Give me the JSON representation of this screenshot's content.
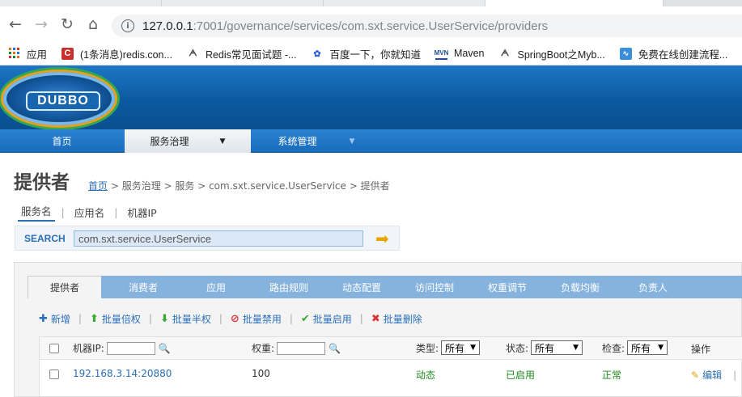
{
  "browser": {
    "url_host": "127.0.0.1",
    "url_rest": ":7001/governance/services/com.sxt.service.UserService/providers",
    "bookmarks": [
      {
        "icon": "apps-grid-icon",
        "label": "应用"
      },
      {
        "icon": "csdn-icon",
        "label": "(1条消息)redis.con..."
      },
      {
        "icon": "fox-icon",
        "label": "Redis常见面试题 -..."
      },
      {
        "icon": "baidu-paw-icon",
        "label": "百度一下，你就知道"
      },
      {
        "icon": "mvn-icon",
        "label": "Maven"
      },
      {
        "icon": "fox-icon",
        "label": "SpringBoot之Myb..."
      },
      {
        "icon": "chart-icon",
        "label": "免费在线创建流程..."
      }
    ]
  },
  "header": {
    "logo_text": "DUBBO"
  },
  "nav": {
    "items": [
      {
        "label": "首页"
      },
      {
        "label": "服务治理",
        "caret": "▼"
      },
      {
        "label": "系统管理",
        "caret": "▼"
      }
    ]
  },
  "page": {
    "title": "提供者",
    "breadcrumb": {
      "home": "首页",
      "trail": " > 服务治理 > 服务 > com.sxt.service.UserService > 提供者"
    }
  },
  "search": {
    "tabs": [
      "服务名",
      "应用名",
      "机器IP"
    ],
    "label": "SEARCH",
    "value": "com.sxt.service.UserService"
  },
  "tabs": [
    "提供者",
    "消费者",
    "应用",
    "路由规则",
    "动态配置",
    "访问控制",
    "权重调节",
    "负载均衡",
    "负责人"
  ],
  "actions": [
    {
      "icon": "plus-icon",
      "glyph": "✚",
      "label": "新增",
      "color": "#2a6fb8"
    },
    {
      "icon": "up-arrow-icon",
      "glyph": "⬆",
      "label": "批量倍权",
      "color": "#3aa83a"
    },
    {
      "icon": "down-arrow-icon",
      "glyph": "⬇",
      "label": "批量半权",
      "color": "#3aa83a"
    },
    {
      "icon": "ban-icon",
      "glyph": "⊘",
      "label": "批量禁用",
      "color": "#d33"
    },
    {
      "icon": "check-icon",
      "glyph": "✔",
      "label": "批量启用",
      "color": "#3aa83a"
    },
    {
      "icon": "cross-icon",
      "glyph": "✖",
      "label": "批量删除",
      "color": "#d33"
    }
  ],
  "table": {
    "headers": {
      "ip": "机器IP:",
      "weight": "权重:",
      "type": "类型:",
      "status": "状态:",
      "check": "检查:",
      "op": "操作"
    },
    "filters": {
      "type": "所有",
      "status": "所有",
      "check": "所有"
    },
    "rows": [
      {
        "ip": "192.168.3.14:20880",
        "weight": "100",
        "type": "动态",
        "status": "已启用",
        "check": "正常",
        "op": "编辑"
      }
    ]
  }
}
